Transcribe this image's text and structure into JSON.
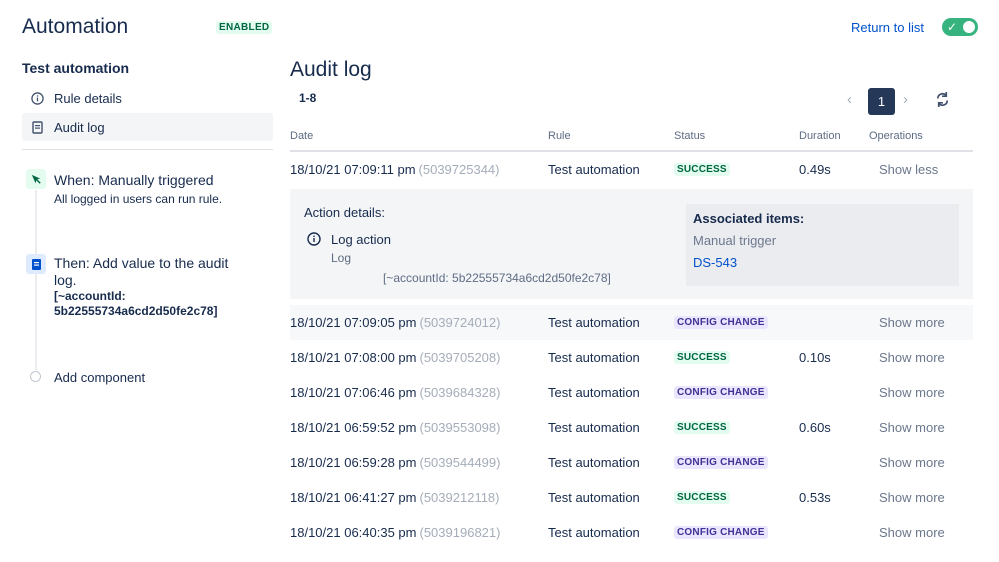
{
  "header": {
    "title": "Automation",
    "enabled_badge": "ENABLED",
    "return_link": "Return to list",
    "toggle_check": "✓"
  },
  "sidebar": {
    "rule_name": "Test automation",
    "nav": [
      {
        "label": "Rule details",
        "icon": "info-icon"
      },
      {
        "label": "Audit log",
        "icon": "document-icon",
        "active": true
      }
    ],
    "components": [
      {
        "title": "When: Manually triggered",
        "subtitle": "All logged in users can run rule.",
        "icon": "cursor-click-icon"
      },
      {
        "title_line1": "Then: Add value to the audit",
        "title_line2": "log.",
        "value_line1": "[~accountId:",
        "value_line2": "5b22555734a6cd2d50fe2c78]",
        "icon": "audit-log-icon"
      }
    ],
    "add_component": "Add component"
  },
  "main": {
    "title": "Audit log",
    "range": "1-8",
    "pagination": {
      "prev": "‹",
      "current": "1",
      "next": "›"
    },
    "columns": [
      "Date",
      "Rule",
      "Status",
      "Duration",
      "Operations"
    ],
    "rows": [
      {
        "date": "18/10/21 07:09:11 pm",
        "id": "(5039725344)",
        "rule": "Test automation",
        "status": "SUCCESS",
        "duration": "0.49s",
        "op": "Show less"
      },
      {
        "date": "18/10/21 07:09:05 pm",
        "id": "(5039724012)",
        "rule": "Test automation",
        "status": "CONFIG CHANGE",
        "duration": "",
        "op": "Show more"
      },
      {
        "date": "18/10/21 07:08:00 pm",
        "id": "(5039705208)",
        "rule": "Test automation",
        "status": "SUCCESS",
        "duration": "0.10s",
        "op": "Show more"
      },
      {
        "date": "18/10/21 07:06:46 pm",
        "id": "(5039684328)",
        "rule": "Test automation",
        "status": "CONFIG CHANGE",
        "duration": "",
        "op": "Show more"
      },
      {
        "date": "18/10/21 06:59:52 pm",
        "id": "(5039553098)",
        "rule": "Test automation",
        "status": "SUCCESS",
        "duration": "0.60s",
        "op": "Show more"
      },
      {
        "date": "18/10/21 06:59:28 pm",
        "id": "(5039544499)",
        "rule": "Test automation",
        "status": "CONFIG CHANGE",
        "duration": "",
        "op": "Show more"
      },
      {
        "date": "18/10/21 06:41:27 pm",
        "id": "(5039212118)",
        "rule": "Test automation",
        "status": "SUCCESS",
        "duration": "0.53s",
        "op": "Show more"
      },
      {
        "date": "18/10/21 06:40:35 pm",
        "id": "(5039196821)",
        "rule": "Test automation",
        "status": "CONFIG CHANGE",
        "duration": "",
        "op": "Show more"
      }
    ],
    "details": {
      "title": "Action details:",
      "action": "Log action",
      "action_sub": "Log",
      "message": "[~accountId: 5b22555734a6cd2d50fe2c78]",
      "associated_title": "Associated items:",
      "associated_trigger": "Manual trigger",
      "associated_issue": "DS-543"
    }
  },
  "colors": {
    "success": "#006644",
    "config_change": "#403294",
    "link": "#0052cc",
    "toggle_on": "#36b37e"
  }
}
